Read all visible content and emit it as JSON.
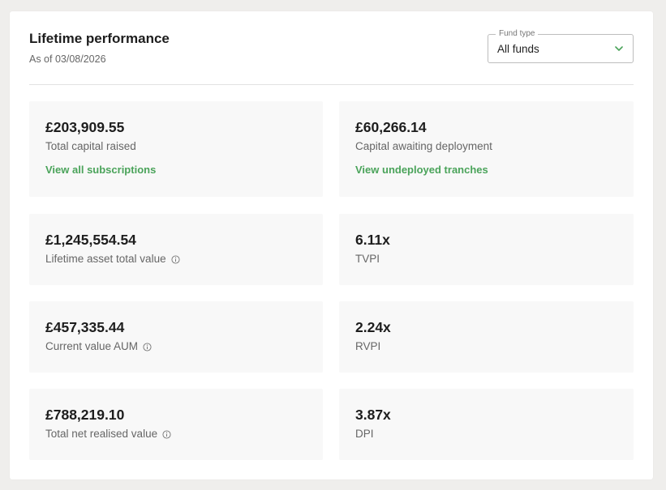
{
  "header": {
    "title": "Lifetime performance",
    "as_of": "As of 03/08/2026"
  },
  "fund_type": {
    "legend": "Fund type",
    "selected": "All funds",
    "icon": "chevron-down-icon"
  },
  "colors": {
    "accent": "#4aa35a",
    "tile_bg": "#f8f8f8"
  },
  "metrics": {
    "capital_raised": {
      "value": "£203,909.55",
      "label": "Total capital raised",
      "link": "View all subscriptions"
    },
    "capital_awaiting": {
      "value": "£60,266.14",
      "label": "Capital awaiting deployment",
      "link": "View undeployed tranches"
    },
    "lifetime_asset": {
      "value": "£1,245,554.54",
      "label": "Lifetime asset total value",
      "icon": "info-icon"
    },
    "tvpi": {
      "value": "6.11x",
      "label": "TVPI"
    },
    "current_aum": {
      "value": "£457,335.44",
      "label": "Current value AUM",
      "icon": "info-icon"
    },
    "rvpi": {
      "value": "2.24x",
      "label": "RVPI"
    },
    "net_realised": {
      "value": "£788,219.10",
      "label": "Total net realised value",
      "icon": "info-icon"
    },
    "dpi": {
      "value": "3.87x",
      "label": "DPI"
    }
  }
}
